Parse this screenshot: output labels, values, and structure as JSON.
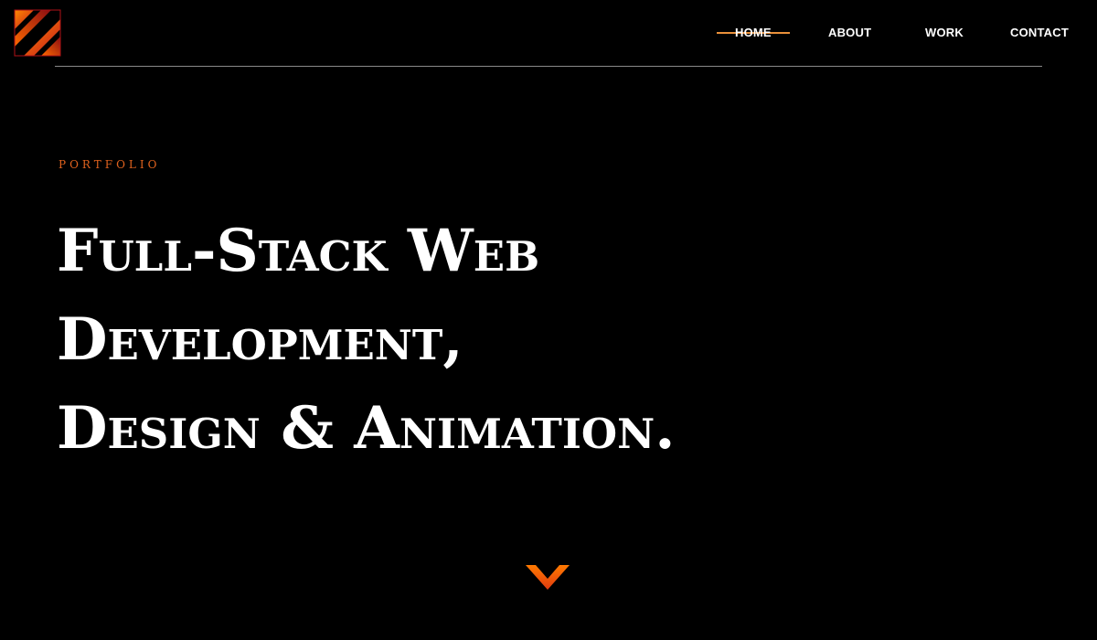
{
  "brand": {
    "logo_icon": "logo-mark-icon",
    "accent_colors": [
      "#e0621e",
      "#ff7a00",
      "#c4161c"
    ]
  },
  "nav": {
    "items": [
      {
        "label": "HOME",
        "active": true
      },
      {
        "label": "ABOUT",
        "active": false
      },
      {
        "label": "WORK",
        "active": false
      },
      {
        "label": "CONTACT",
        "active": false
      }
    ],
    "active_indicator_color": "#e9903a"
  },
  "hero": {
    "eyebrow": "PORTFOLIO",
    "headline_lines": [
      "Full-Stack Web",
      "Development,",
      "Design & Animation."
    ],
    "scroll_icon": "chevron-down-icon"
  }
}
